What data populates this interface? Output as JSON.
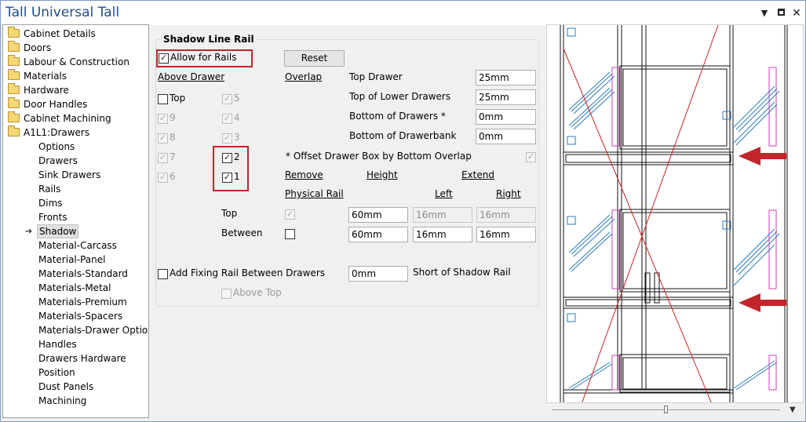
{
  "window": {
    "title": "Tall Universal Tall"
  },
  "titlebar_icons": [
    "chevron-down-icon",
    "restore-icon",
    "close-icon"
  ],
  "tree": {
    "folders": [
      "Cabinet Details",
      "Doors",
      "Labour & Construction",
      "Materials",
      "Hardware",
      "Door Handles",
      "Cabinet Machining",
      "A1L1:Drawers"
    ],
    "children": [
      "Options",
      "Drawers",
      "Sink Drawers",
      "Rails",
      "Dims",
      "Fronts",
      "Shadow",
      "Material-Carcass",
      "Material-Panel",
      "Materials-Standard",
      "Materials-Metal",
      "Materials-Premium",
      "Materials-Spacers",
      "Materials-Drawer Options",
      "Handles",
      "Drawers Hardware",
      "Position",
      "Dust Panels",
      "Machining"
    ],
    "selected": "Shadow"
  },
  "shadow": {
    "group_title": "Shadow Line Rail",
    "allow_for_rails": {
      "label": "Allow for Rails",
      "checked": true
    },
    "reset_label": "Reset",
    "above_drawer_label": "Above Drawer",
    "overlap_label": "Overlap",
    "above_checks": [
      {
        "label": "Top",
        "checked": false,
        "enabled": true
      },
      {
        "label": "5",
        "checked": true,
        "enabled": false
      },
      {
        "label": "9",
        "checked": true,
        "enabled": false
      },
      {
        "label": "4",
        "checked": true,
        "enabled": false
      },
      {
        "label": "8",
        "checked": true,
        "enabled": false
      },
      {
        "label": "3",
        "checked": true,
        "enabled": false
      },
      {
        "label": "7",
        "checked": true,
        "enabled": false
      },
      {
        "label": "2",
        "checked": true,
        "enabled": true
      },
      {
        "label": "6",
        "checked": true,
        "enabled": false
      },
      {
        "label": "1",
        "checked": true,
        "enabled": true
      }
    ],
    "overlap_fields": [
      {
        "label": "Top Drawer",
        "value": "25mm"
      },
      {
        "label": "Top of Lower Drawers",
        "value": "25mm"
      },
      {
        "label": "Bottom of Drawers *",
        "value": "0mm"
      },
      {
        "label": "Bottom of Drawerbank",
        "value": "0mm"
      }
    ],
    "offset_drawer_box": {
      "label": "* Offset Drawer Box by Bottom Overlap",
      "checked": true
    },
    "headers": {
      "remove": "Remove",
      "height": "Height",
      "extend": "Extend",
      "physical_rail": "Physical Rail",
      "left": "Left",
      "right": "Right"
    },
    "rows": [
      {
        "label": "Top",
        "remove": true,
        "remove_enabled": false,
        "height": "60mm",
        "left": "16mm",
        "right": "16mm",
        "lr_enabled": false
      },
      {
        "label": "Between",
        "remove": false,
        "remove_enabled": true,
        "height": "60mm",
        "left": "16mm",
        "right": "16mm",
        "lr_enabled": true
      }
    ],
    "fixing_rail": {
      "label": "Add Fixing Rail Between Drawers",
      "checked": false,
      "value": "0mm",
      "short_label": "Short of Shadow Rail"
    },
    "above_top": {
      "label": "Above Top",
      "checked": false,
      "enabled": false
    }
  },
  "colors": {
    "accent_red": "#c0262b",
    "title_blue": "#1e4e8c",
    "drawing_blue": "#2a7bc6",
    "drawing_magenta": "#d63fb8"
  }
}
